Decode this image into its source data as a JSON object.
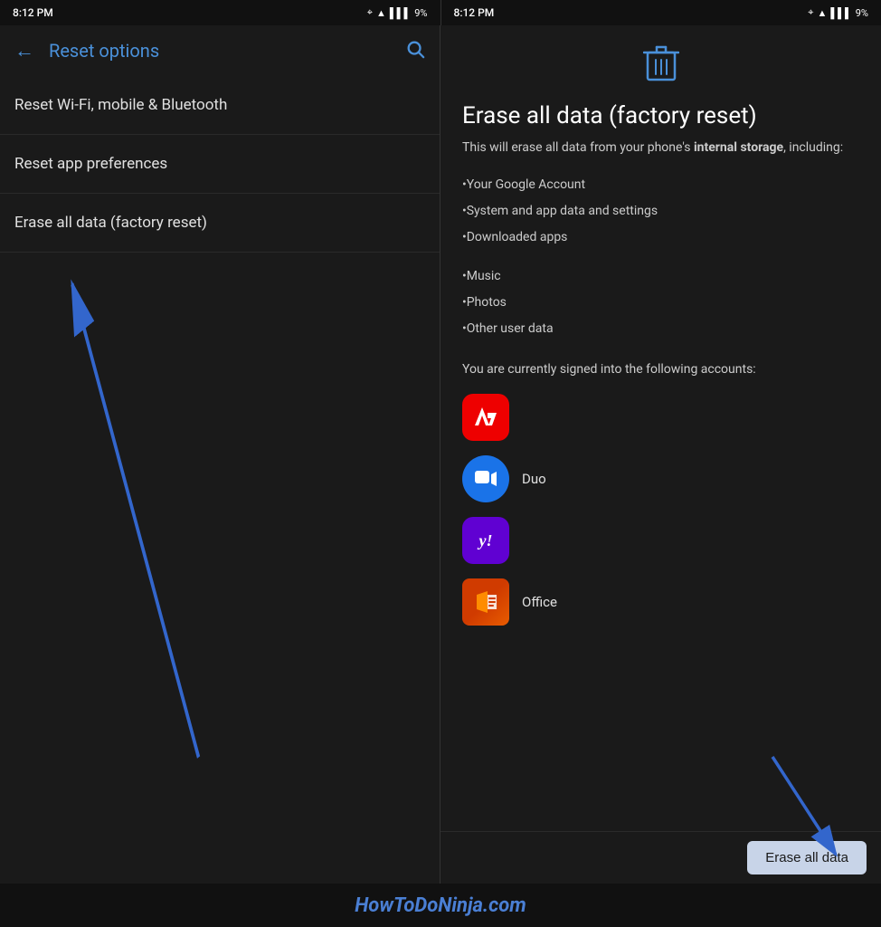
{
  "statusBar": {
    "left": {
      "time": "8:12 PM",
      "icons": "🔵 ▲ 📶 9%"
    },
    "right": {
      "time": "8:12 PM",
      "icons": "🔵 ▲ 📶 9%"
    }
  },
  "leftScreen": {
    "toolbar": {
      "back_label": "←",
      "title": "Reset options",
      "search_label": "🔍"
    },
    "menuItems": [
      {
        "id": "wifi",
        "label": "Reset Wi-Fi, mobile & Bluetooth"
      },
      {
        "id": "app-prefs",
        "label": "Reset app preferences"
      },
      {
        "id": "factory",
        "label": "Erase all data (factory reset)"
      }
    ]
  },
  "rightScreen": {
    "trashIcon": "🗑",
    "title": "Erase all data (factory reset)",
    "description_prefix": "This will erase all data from your phone's ",
    "description_bold": "internal storage",
    "description_suffix": ", including:",
    "dataItems": [
      "•Your Google Account",
      "•System and app data and settings",
      "•Downloaded apps",
      "•Music",
      "•Photos",
      "•Other user data"
    ],
    "accountsText": "You are currently signed into the following accounts:",
    "accounts": [
      {
        "id": "adobe",
        "label": "",
        "colorClass": "adobe",
        "icon": "A"
      },
      {
        "id": "duo",
        "label": "Duo",
        "colorClass": "duo",
        "icon": "▶"
      },
      {
        "id": "yahoo",
        "label": "",
        "colorClass": "yahoo",
        "icon": "y!"
      },
      {
        "id": "office",
        "label": "Office",
        "colorClass": "office",
        "icon": ""
      }
    ],
    "eraseButtonLabel": "Erase all data"
  },
  "watermark": {
    "text": "HowToDoNinja.com"
  }
}
